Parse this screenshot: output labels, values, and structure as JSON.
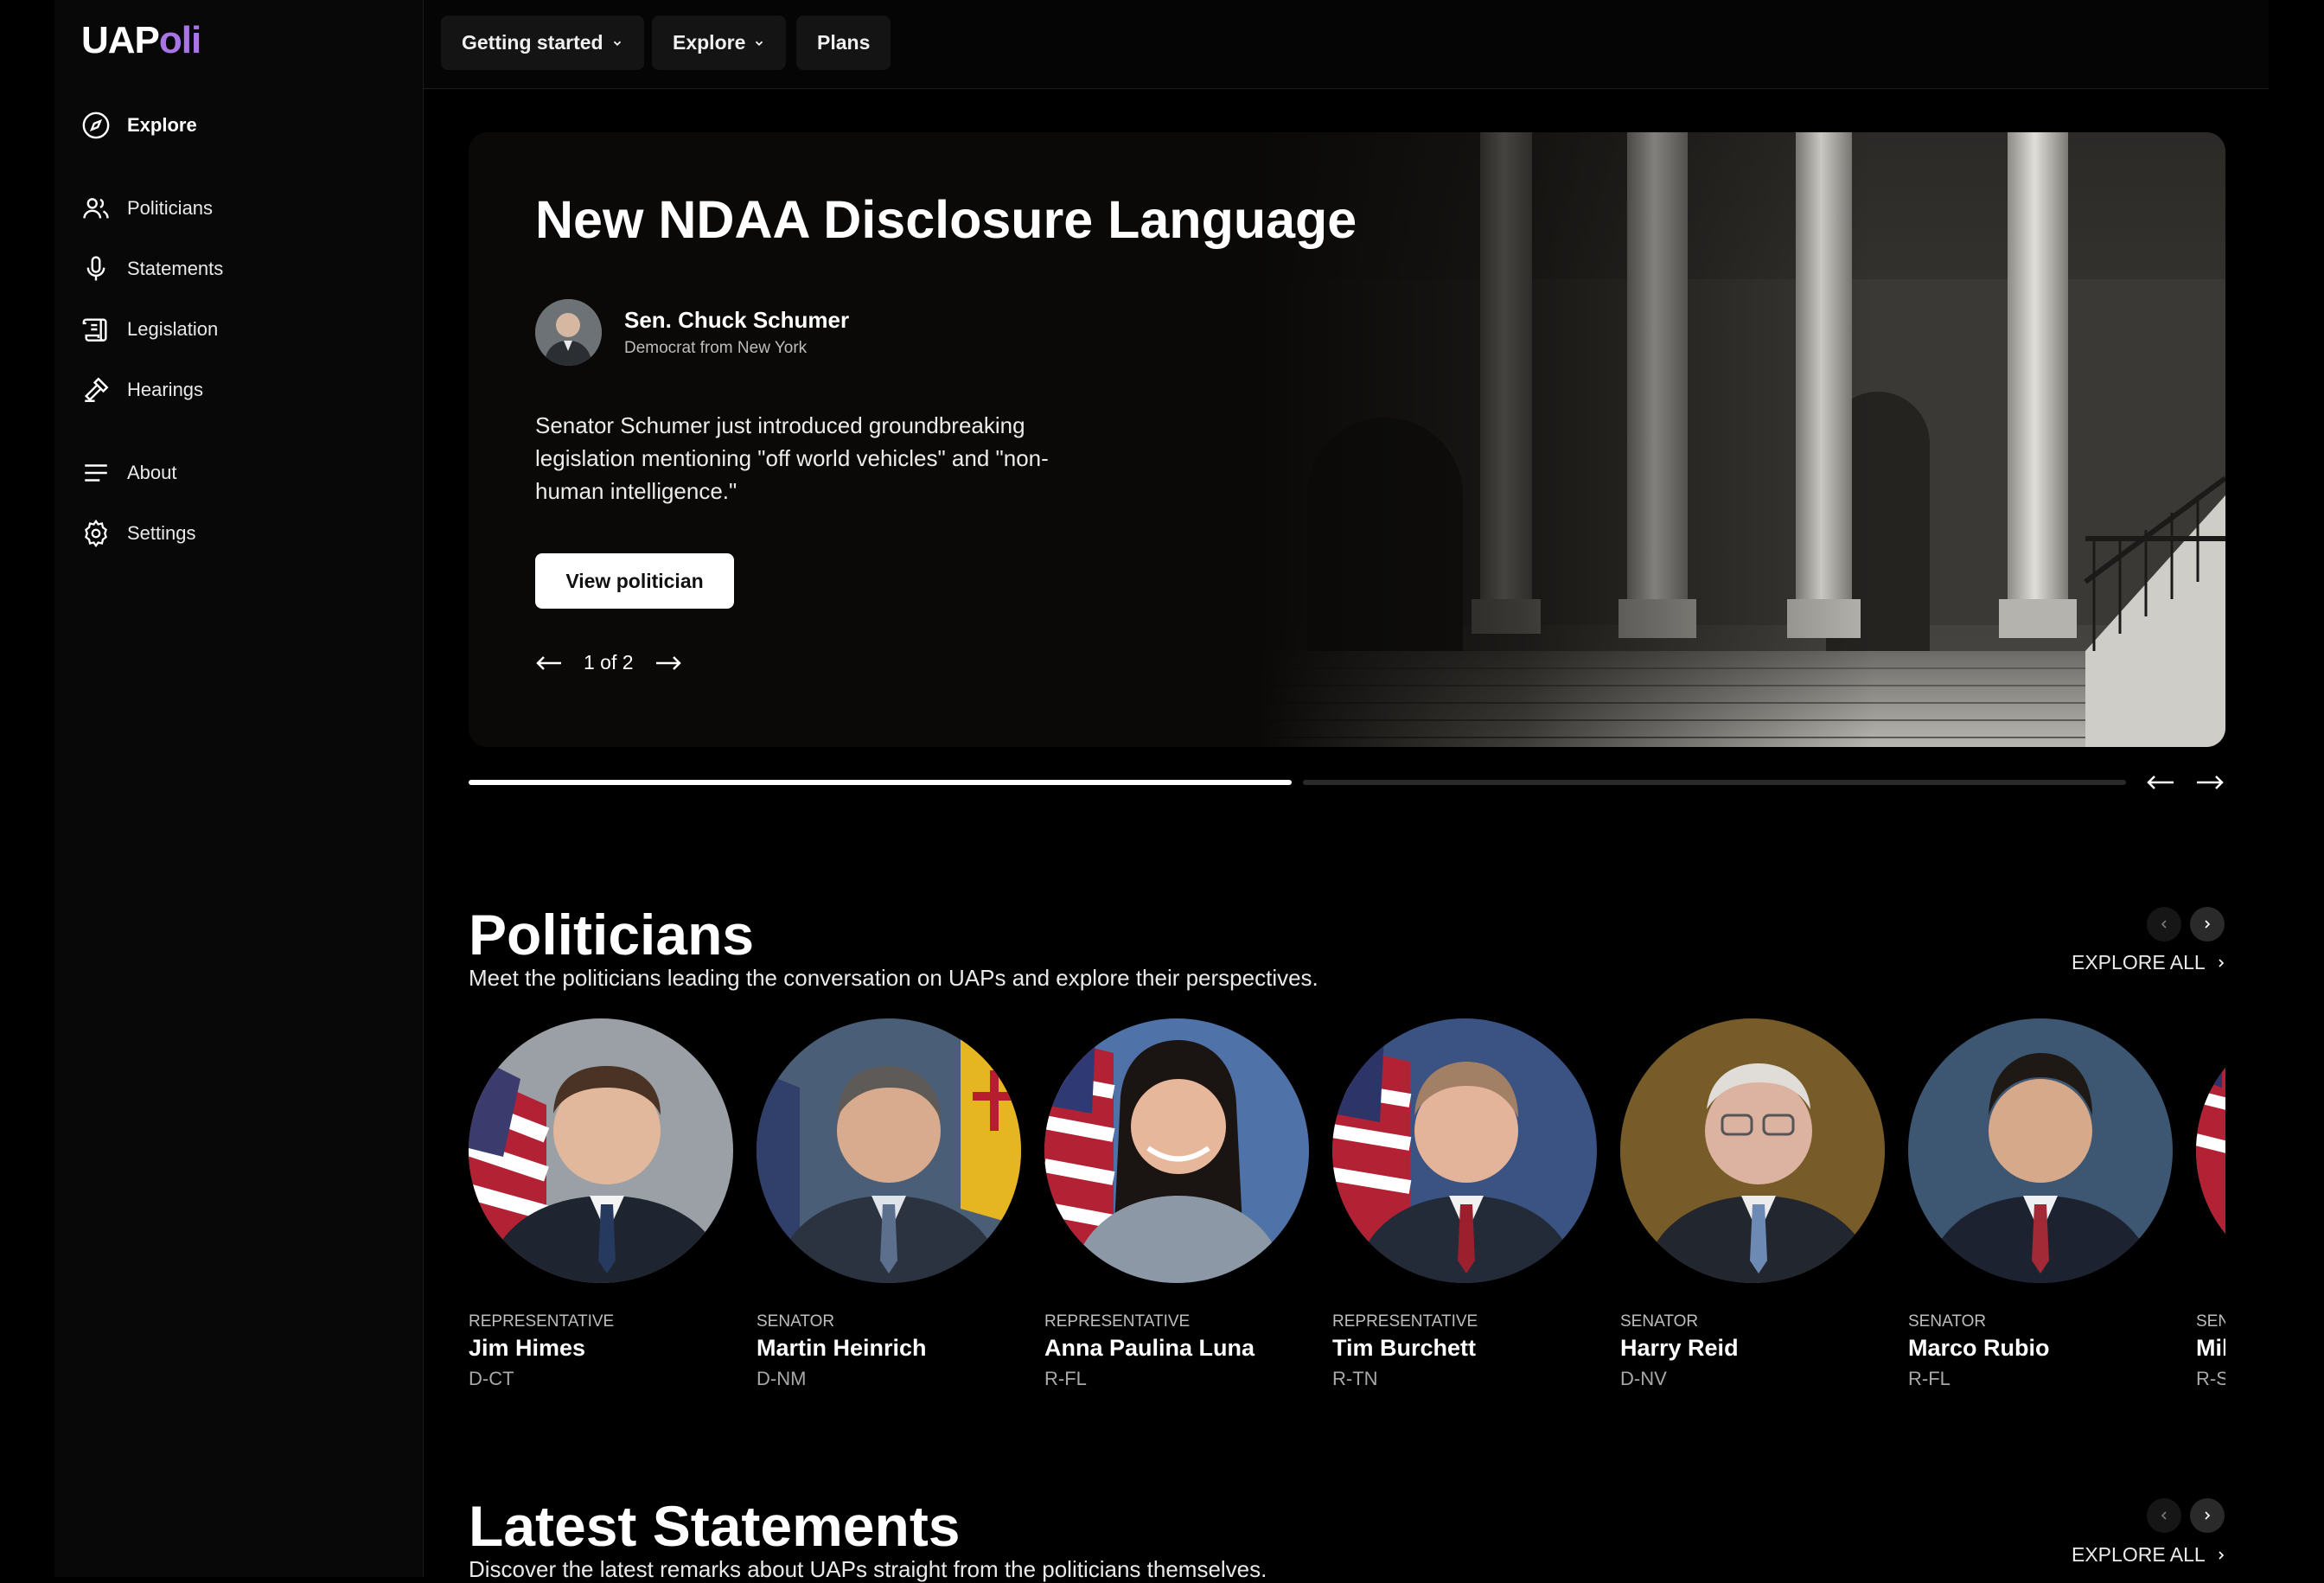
{
  "app": {
    "logo_part1": "UAP",
    "logo_part2": "oli"
  },
  "sidebar": {
    "items": [
      {
        "label": "Explore",
        "icon": "compass-icon"
      },
      {
        "label": "Politicians",
        "icon": "users-icon"
      },
      {
        "label": "Statements",
        "icon": "microphone-icon"
      },
      {
        "label": "Legislation",
        "icon": "scroll-icon"
      },
      {
        "label": "Hearings",
        "icon": "gavel-icon"
      },
      {
        "label": "About",
        "icon": "menu-lines-icon"
      },
      {
        "label": "Settings",
        "icon": "gear-icon"
      }
    ]
  },
  "topbar": {
    "getting_started": "Getting started",
    "explore": "Explore",
    "plans": "Plans"
  },
  "hero": {
    "title": "New NDAA Disclosure Language",
    "politician_name": "Sen. Chuck Schumer",
    "politician_sub": "Democrat from New York",
    "description": "Senator Schumer just introduced groundbreaking legislation mentioning \"off world vehicles\" and \"non-human intelligence.\"",
    "button": "View politician",
    "pager": "1 of 2",
    "slide_index": 1,
    "slide_count": 2
  },
  "politicians_section": {
    "title": "Politicians",
    "subtitle": "Meet the politicians leading the conversation on UAPs and explore their perspectives.",
    "explore_all": "EXPLORE ALL",
    "people": [
      {
        "role": "Representative",
        "name": "Jim Himes",
        "party": "D-CT"
      },
      {
        "role": "Senator",
        "name": "Martin Heinrich",
        "party": "D-NM"
      },
      {
        "role": "Representative",
        "name": "Anna Paulina Luna",
        "party": "R-FL"
      },
      {
        "role": "Representative",
        "name": "Tim Burchett",
        "party": "R-TN"
      },
      {
        "role": "Senator",
        "name": "Harry Reid",
        "party": "D-NV"
      },
      {
        "role": "Senator",
        "name": "Marco Rubio",
        "party": "R-FL"
      },
      {
        "role": "Sen",
        "name": "Mil",
        "party": "R-S"
      }
    ]
  },
  "statements_section": {
    "title": "Latest Statements",
    "subtitle": "Discover the latest remarks about UAPs straight from the politicians themselves.",
    "explore_all": "EXPLORE ALL"
  },
  "colors": {
    "accent": "#a874e6",
    "background": "#000000",
    "sidebar": "#080808"
  }
}
